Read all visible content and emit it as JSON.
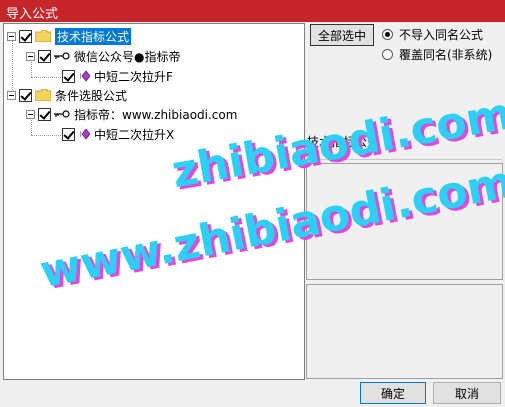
{
  "window": {
    "title": "导入公式"
  },
  "tree": {
    "root1": {
      "label": "技术指标公式"
    },
    "child1": {
      "label": "微信公众号●指标帝"
    },
    "leaf1": {
      "label": "中短二次拉升F"
    },
    "root2": {
      "label": "条件选股公式"
    },
    "child2": {
      "label": "指标帝：www.zhibiaodi.com"
    },
    "leaf2": {
      "label": "中短二次拉升X"
    }
  },
  "options": {
    "select_all_label": "全部选中",
    "radio_no_import": "不导入同名公式",
    "radio_overwrite": "覆盖同名(非系统)"
  },
  "info": {
    "type_label": "技术指标公式"
  },
  "buttons": {
    "ok": "确定",
    "cancel": "取消"
  },
  "watermark": {
    "line1": "zhibiaodi.com",
    "line2": "www.zhibiaodi.com"
  },
  "colors": {
    "titlebar": "#c6262a",
    "selection": "#0078d7",
    "watermark": "#2bd0f5",
    "watermark_shadow": "#e04ad8"
  }
}
